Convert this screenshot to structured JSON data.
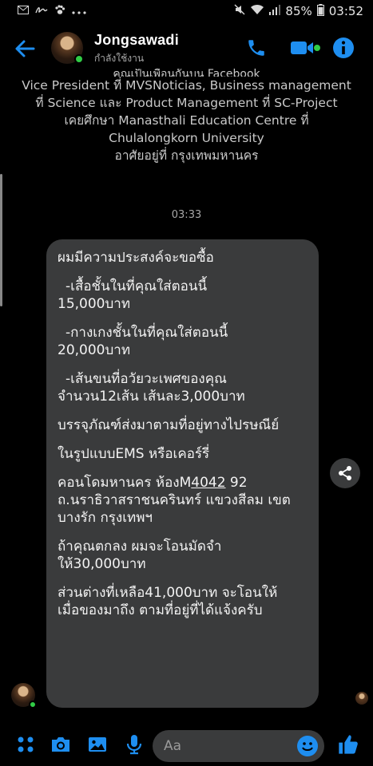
{
  "status_bar": {
    "left_icons": [
      "gmail-icon",
      "signature-icon",
      "paw-icon",
      "more-icon"
    ],
    "battery": "85%",
    "time": "03:52"
  },
  "header": {
    "contact_name": "Jongsawadi",
    "contact_status": "กำลังใช้งาน",
    "accent_color": "#1e8ef0",
    "online_color": "#31cc46"
  },
  "intro": {
    "cut_line": "คุณเป็นเพื่อนกันบน Facebook",
    "lines": [
      "Vice President ที่ MVSNoticias, Business management",
      "ที่ Science และ Product Management ที่ SC-Project",
      "เคยศึกษา Manasthali Education Centre ที่",
      "Chulalongkorn University",
      "อาศัยอยู่ที่ กรุงเทพมหานคร"
    ]
  },
  "timestamp": "03:33",
  "message": {
    "l1": "ผมมีความประสงค์จะขอซื้อ",
    "l2": "-เสื้อชั้นในที่คุณใส่ตอนนี้",
    "l3": "15,000บาท",
    "l4": "-กางเกงชั้นในที่คุณใส่ตอนนี้",
    "l5": "20,000บาท",
    "l6": "-เส้นขนที่อวัยวะเพศของคุณ",
    "l7": "จำนวน12เส้น เส้นละ3,000บาท",
    "l8": "บรรจุภัณฑ์ส่งมาตามที่อยู่ทางไปรษณีย์",
    "l9": "ในรูปแบบEMS หรือเคอร์รี่",
    "l10a": "คอนโดมหานคร ห้องM",
    "l10b": "4042",
    "l10c": " 92",
    "l11": "ถ.นราธิวาสราชนครินทร์ แขวงสีลม เขต",
    "l12": "บางรัก กรุงเทพฯ",
    "l13": "ถ้าคุณตกลง ผมจะโอนมัดจำ",
    "l14": "ให้30,000บาท",
    "l15": "ส่วนต่างที่เหลือ41,000บาท จะโอนให้",
    "l16": "เมื่อของมาถึง ตามที่อยู่ที่ได้แจ้งครับ"
  },
  "composer": {
    "placeholder": "Aa"
  }
}
